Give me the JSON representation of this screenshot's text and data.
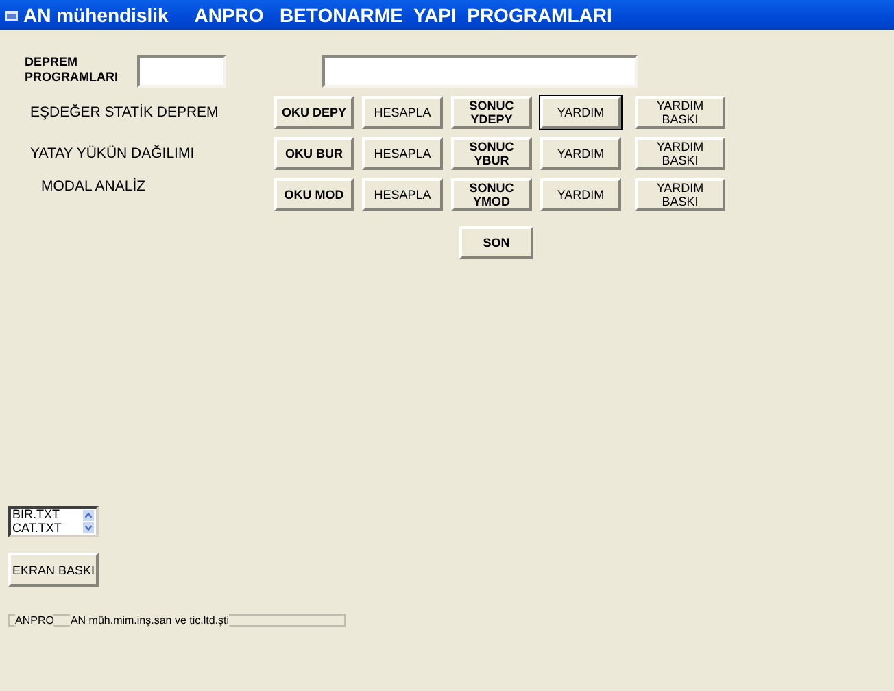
{
  "window": {
    "title": "AN mühendislik     ANPRO   BETONARME  YAPI  PROGRAMLARI"
  },
  "header": {
    "label": "DEPREM PROGRAMLARI"
  },
  "rows": [
    {
      "label": "EŞDEĞER STATİK DEPREM",
      "buttons": [
        {
          "label": "OKU  DEPY",
          "kind": "bold",
          "focused": false
        },
        {
          "label": "HESAPLA",
          "kind": "plain",
          "focused": false
        },
        {
          "label": "SONUC YDEPY",
          "kind": "bold",
          "focused": false
        },
        {
          "label": "YARDIM",
          "kind": "plain",
          "focused": true
        },
        {
          "label": "YARDIM BASKI",
          "kind": "plain",
          "focused": false
        }
      ]
    },
    {
      "label": "YATAY YÜKÜN DAĞILIMI",
      "buttons": [
        {
          "label": "OKU BUR",
          "kind": "bold",
          "focused": false
        },
        {
          "label": "HESAPLA",
          "kind": "plain",
          "focused": false
        },
        {
          "label": "SONUC YBUR",
          "kind": "bold",
          "focused": false
        },
        {
          "label": "YARDIM",
          "kind": "plain",
          "focused": false
        },
        {
          "label": "YARDIM BASKI",
          "kind": "plain",
          "focused": false
        }
      ]
    },
    {
      "label": "MODAL ANALİZ",
      "buttons": [
        {
          "label": "OKU MOD",
          "kind": "bold",
          "focused": false
        },
        {
          "label": "HESAPLA",
          "kind": "plain",
          "focused": false
        },
        {
          "label": "SONUC YMOD",
          "kind": "bold",
          "focused": false
        },
        {
          "label": "YARDIM",
          "kind": "plain",
          "focused": false
        },
        {
          "label": "YARDIM BASKI",
          "kind": "plain",
          "focused": false
        }
      ]
    }
  ],
  "exit_button": "SON",
  "file_list": [
    "BIR.TXT",
    "CAT.TXT"
  ],
  "print_button": "EKRAN BASKI",
  "status": {
    "frame_title": "ANPRO",
    "text": "AN müh.mim.inş.san ve tic.ltd.şti"
  }
}
